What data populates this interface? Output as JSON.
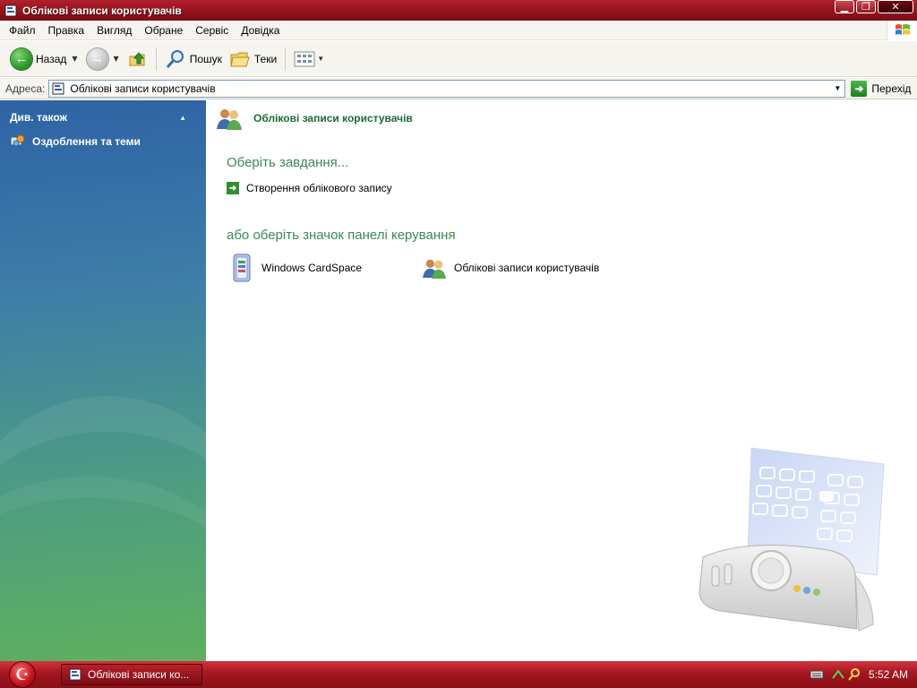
{
  "window": {
    "title": "Облікові записи користувачів",
    "controls": {
      "minimize": "▁",
      "maximize": "❐",
      "close": "✕"
    }
  },
  "menu": {
    "items": [
      "Файл",
      "Правка",
      "Вигляд",
      "Обране",
      "Сервіс",
      "Довідка"
    ]
  },
  "toolbar": {
    "back_label": "Назад",
    "search_label": "Пошук",
    "folders_label": "Теки"
  },
  "address": {
    "label": "Адреса:",
    "value": "Облікові записи користувачів",
    "go_label": "Перехід"
  },
  "sidebar": {
    "header": "Див. також",
    "items": [
      {
        "label": "Оздоблення та теми",
        "icon": "themes-icon"
      }
    ]
  },
  "content": {
    "breadcrumb": "Облікові записи користувачів",
    "pick_task_title": "Оберіть завдання...",
    "tasks": [
      "Створення облікового запису"
    ],
    "pick_icon_title": "або оберіть значок панелі керування",
    "control_panel_items": [
      {
        "label": "Windows CardSpace",
        "icon": "cardspace-icon"
      },
      {
        "label": "Облікові записи користувачів",
        "icon": "user-accounts-icon"
      }
    ]
  },
  "taskbar": {
    "window_button": "Облікові записи ко...",
    "clock": "5:52 AM"
  },
  "colors": {
    "titlebar": "#9b1620",
    "sidebar_top": "#2e63a5",
    "sidebar_bottom": "#5fb05e",
    "section_title": "#3a8a54",
    "taskbar": "#a41620"
  }
}
